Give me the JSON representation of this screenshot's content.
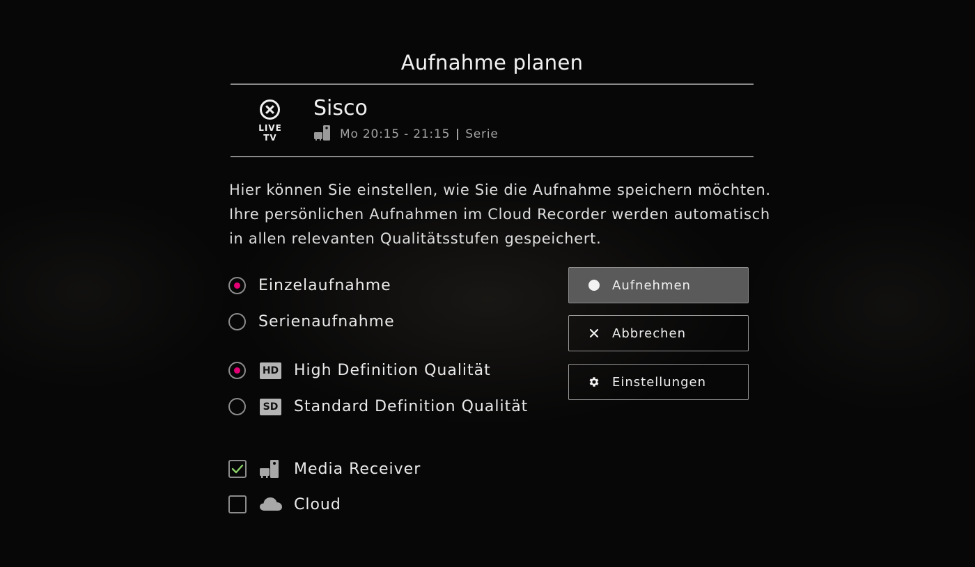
{
  "dialog": {
    "title": "Aufnahme planen"
  },
  "program": {
    "channel_logo_text": "LIVE TV",
    "title": "Sisco",
    "time": "Mo 20:15 - 21:15",
    "genre": "Serie",
    "device_icon": "media-receiver-icon"
  },
  "description": [
    "Hier können Sie einstellen, wie Sie die Aufnahme speichern möchten.",
    "Ihre persönlichen Aufnahmen im Cloud Recorder werden automatisch",
    "in allen relevanten Qualitätsstufen gespeichert."
  ],
  "recording_type": {
    "options": [
      {
        "label": "Einzelaufnahme",
        "selected": true
      },
      {
        "label": "Serienaufnahme",
        "selected": false
      }
    ]
  },
  "quality": {
    "options": [
      {
        "badge": "HD",
        "label": "High Definition Qualität",
        "selected": true
      },
      {
        "badge": "SD",
        "label": "Standard Definition Qualität",
        "selected": false
      }
    ]
  },
  "storage": {
    "options": [
      {
        "icon": "media-receiver-icon",
        "label": "Media Receiver",
        "checked": true
      },
      {
        "icon": "cloud-icon",
        "label": "Cloud",
        "checked": false
      }
    ]
  },
  "actions": {
    "record": {
      "label": "Aufnehmen",
      "icon": "record-dot-icon",
      "focused": true
    },
    "cancel": {
      "label": "Abbrechen",
      "icon": "close-icon"
    },
    "settings": {
      "label": "Einstellungen",
      "icon": "gear-icon"
    }
  },
  "colors": {
    "accent": "#e20074",
    "check": "#8cd26a",
    "background": "#070707",
    "focused_button": "#5a5a5a"
  }
}
